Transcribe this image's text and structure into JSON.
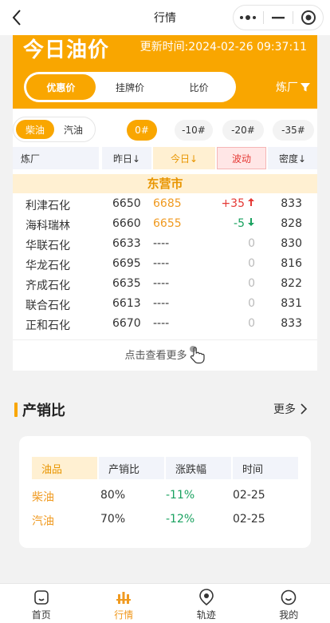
{
  "nav": {
    "title": "行情"
  },
  "hero": {
    "title": "今日油价",
    "update_time": "更新时间:2024-02-26 09:37:11",
    "tabs": [
      "优惠价",
      "挂牌价",
      "比价"
    ],
    "refinery_filter": "炼厂"
  },
  "filters": {
    "fuels": [
      "柴油",
      "汽油"
    ],
    "grades": [
      "0#",
      "-10#",
      "-20#",
      "-35#"
    ]
  },
  "table": {
    "headers": {
      "refinery": "炼厂",
      "yesterday": "昨日↓",
      "today": "今日↓",
      "change": "波动",
      "density": "密度↓"
    },
    "city": "东营市",
    "rows": [
      {
        "name": "利津石化",
        "yesterday": "6650",
        "today": "6685",
        "change": "+35",
        "dir": "up",
        "density": "833"
      },
      {
        "name": "海科瑞林",
        "yesterday": "6660",
        "today": "6655",
        "change": "-5",
        "dir": "down",
        "density": "828"
      },
      {
        "name": "华联石化",
        "yesterday": "6633",
        "today": "----",
        "change": "0",
        "dir": "none",
        "density": "830"
      },
      {
        "name": "华龙石化",
        "yesterday": "6695",
        "today": "----",
        "change": "0",
        "dir": "none",
        "density": "816"
      },
      {
        "name": "齐成石化",
        "yesterday": "6635",
        "today": "----",
        "change": "0",
        "dir": "none",
        "density": "822"
      },
      {
        "name": "联合石化",
        "yesterday": "6613",
        "today": "----",
        "change": "0",
        "dir": "none",
        "density": "831"
      },
      {
        "name": "正和石化",
        "yesterday": "6670",
        "today": "----",
        "change": "0",
        "dir": "none",
        "density": "833"
      }
    ],
    "more": "点击查看更多"
  },
  "ratio": {
    "title": "产销比",
    "more": "更多",
    "headers": [
      "油品",
      "产销比",
      "涨跌幅",
      "时间"
    ],
    "rows": [
      {
        "name": "柴油",
        "ratio": "80%",
        "change": "-11%",
        "time": "02-25"
      },
      {
        "name": "汽油",
        "ratio": "70%",
        "change": "-12%",
        "time": "02-25"
      }
    ]
  },
  "tabbar": [
    "首页",
    "行情",
    "轨迹",
    "我的"
  ],
  "colors": {
    "accent": "#f9a600",
    "up": "#e53935",
    "down": "#1aa260"
  }
}
